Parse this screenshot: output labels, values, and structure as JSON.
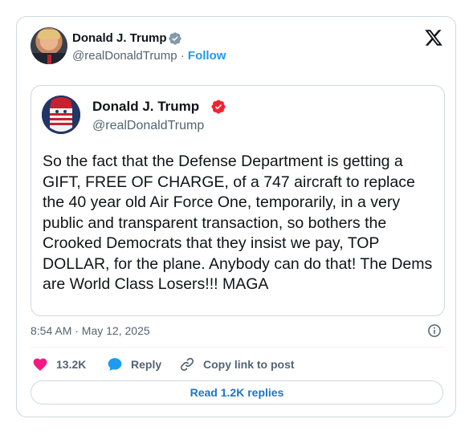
{
  "author": {
    "name": "Donald J. Trump",
    "handle": "@realDonaldTrump",
    "separator": " · ",
    "follow_label": "Follow"
  },
  "quoted_post": {
    "name": "Donald J. Trump",
    "handle": "@realDonaldTrump",
    "text": "So the fact that the Defense Department is getting a GIFT, FREE OF CHARGE, of a 747 aircraft to replace the 40 year old Air Force One, temporarily, in a very public and transparent transaction, so bothers the Crooked Democrats that they insist we pay, TOP DOLLAR, for the plane. Anybody can do that! The Dems are World Class Losers!!! MAGA"
  },
  "timestamp": "8:54 AM · May 12, 2025",
  "actions": {
    "like_count": "13.2K",
    "reply_label": "Reply",
    "copy_label": "Copy link to post"
  },
  "read_replies_label": "Read 1.2K replies",
  "colors": {
    "link_blue": "#1d9bf0",
    "like_pink": "#f91880",
    "verified_gray": "#829aab",
    "verified_red": "#f4212e",
    "text_secondary": "#536471"
  },
  "icons": {
    "verified": "verified-badge-icon",
    "logo": "x-logo-icon",
    "info": "info-icon",
    "like": "heart-icon",
    "reply": "speech-bubble-icon",
    "copy": "link-icon"
  }
}
